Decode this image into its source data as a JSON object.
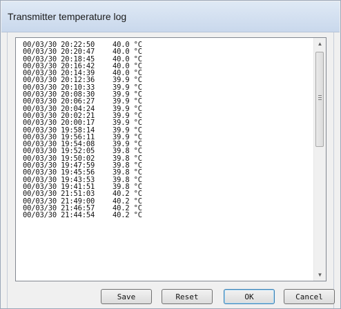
{
  "window": {
    "title": "Transmitter temperature log"
  },
  "log": [
    {
      "ts": "00/03/30 20:22:50",
      "temp": "40.0 °C"
    },
    {
      "ts": "00/03/30 20:20:47",
      "temp": "40.0 °C"
    },
    {
      "ts": "00/03/30 20:18:45",
      "temp": "40.0 °C"
    },
    {
      "ts": "00/03/30 20:16:42",
      "temp": "40.0 °C"
    },
    {
      "ts": "00/03/30 20:14:39",
      "temp": "40.0 °C"
    },
    {
      "ts": "00/03/30 20:12:36",
      "temp": "39.9 °C"
    },
    {
      "ts": "00/03/30 20:10:33",
      "temp": "39.9 °C"
    },
    {
      "ts": "00/03/30 20:08:30",
      "temp": "39.9 °C"
    },
    {
      "ts": "00/03/30 20:06:27",
      "temp": "39.9 °C"
    },
    {
      "ts": "00/03/30 20:04:24",
      "temp": "39.9 °C"
    },
    {
      "ts": "00/03/30 20:02:21",
      "temp": "39.9 °C"
    },
    {
      "ts": "00/03/30 20:00:17",
      "temp": "39.9 °C"
    },
    {
      "ts": "00/03/30 19:58:14",
      "temp": "39.9 °C"
    },
    {
      "ts": "00/03/30 19:56:11",
      "temp": "39.9 °C"
    },
    {
      "ts": "00/03/30 19:54:08",
      "temp": "39.9 °C"
    },
    {
      "ts": "00/03/30 19:52:05",
      "temp": "39.8 °C"
    },
    {
      "ts": "00/03/30 19:50:02",
      "temp": "39.8 °C"
    },
    {
      "ts": "00/03/30 19:47:59",
      "temp": "39.8 °C"
    },
    {
      "ts": "00/03/30 19:45:56",
      "temp": "39.8 °C"
    },
    {
      "ts": "00/03/30 19:43:53",
      "temp": "39.8 °C"
    },
    {
      "ts": "00/03/30 19:41:51",
      "temp": "39.8 °C"
    },
    {
      "ts": "00/03/30 21:51:03",
      "temp": "40.2 °C"
    },
    {
      "ts": "00/03/30 21:49:00",
      "temp": "40.2 °C"
    },
    {
      "ts": "00/03/30 21:46:57",
      "temp": "40.2 °C"
    },
    {
      "ts": "00/03/30 21:44:54",
      "temp": "40.2 °C"
    }
  ],
  "scrollbar": {
    "up_icon": "arrow-up-icon",
    "down_icon": "arrow-down-icon"
  },
  "buttons": {
    "save": "Save",
    "reset": "Reset",
    "ok": "OK",
    "cancel": "Cancel"
  }
}
